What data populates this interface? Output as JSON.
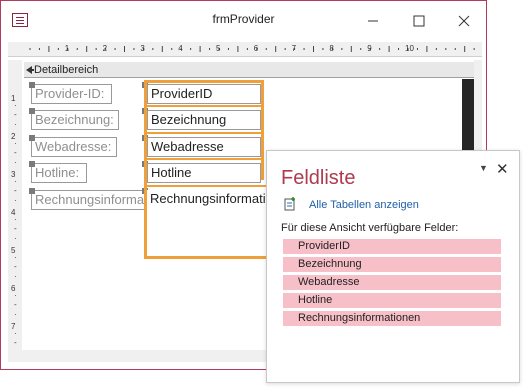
{
  "window": {
    "title": "frmProvider",
    "accent": "#b23a5a"
  },
  "icons": [
    "form-view-icon",
    "minimize-icon",
    "maximize-icon",
    "close-icon",
    "section-arrow-icon",
    "add-table-icon",
    "panel-menu-icon",
    "panel-close-icon"
  ],
  "ruler": {
    "top_numbers": [
      "1",
      "2",
      "3",
      "4",
      "5",
      "6",
      "7",
      "8",
      "9",
      "10"
    ],
    "left_numbers": [
      "1",
      "2",
      "3",
      "4",
      "5",
      "6",
      "7"
    ]
  },
  "section": {
    "label": "Detailbereich"
  },
  "form": {
    "labels": [
      "Provider-ID:",
      "Bezeichnung:",
      "Webadresse:",
      "Hotline:",
      "Rechnungsinformationen:"
    ],
    "fields": [
      "ProviderID",
      "Bezeichnung",
      "Webadresse",
      "Hotline",
      "Rechnungsinformationen"
    ]
  },
  "field_list": {
    "title": "Feldliste",
    "show_all_tables": "Alle Tabellen anzeigen",
    "available_label": "Für diese Ansicht verfügbare Felder:",
    "items": [
      "ProviderID",
      "Bezeichnung",
      "Webadresse",
      "Hotline",
      "Rechnungsinformationen"
    ],
    "item_color": "#f7c0c8",
    "title_color": "#b03a50",
    "link_color": "#1f5fa8"
  }
}
